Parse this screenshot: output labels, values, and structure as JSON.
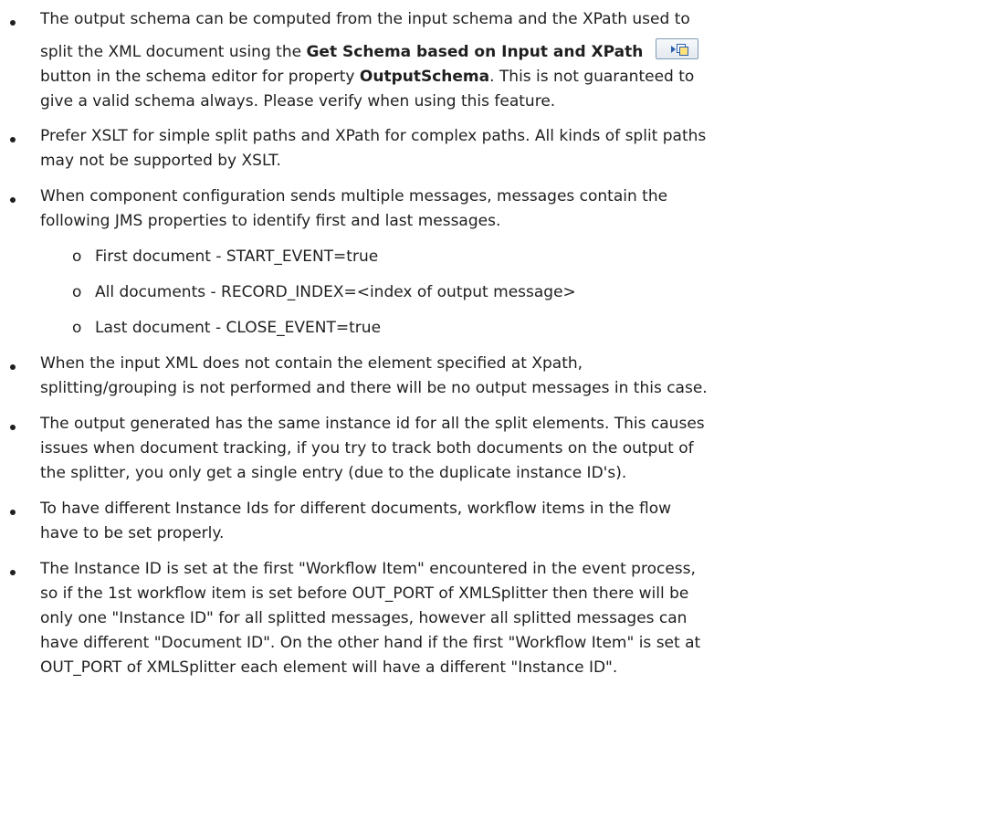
{
  "bullets": [
    {
      "lines": [
        "The output schema can be computed from the input schema and the XPath used to",
        {
          "pre": "split the XML document using the ",
          "bold": "Get Schema based on Input and XPath",
          "post": ""
        },
        {
          "pre": "button in the schema editor for property ",
          "bold": "OutputSchema",
          "post": ". This is not guaranteed to"
        },
        "give a valid schema always. Please verify when using this feature."
      ],
      "button_icon": "get-schema-icon"
    },
    {
      "lines": [
        "Prefer XSLT for simple split paths and XPath for complex paths. All kinds of split paths",
        "may not be supported by XSLT."
      ]
    },
    {
      "lines": [
        "When component configuration sends multiple messages, messages contain the",
        "following JMS properties to identify first and last messages."
      ],
      "sub_items": [
        "First document -  START_EVENT=true",
        "All documents -  RECORD_INDEX=<index of output message>",
        "Last document -  CLOSE_EVENT=true"
      ],
      "sub_marker": "o"
    },
    {
      "lines": [
        "When the input XML does not contain the element specified at Xpath,",
        "splitting/grouping is not performed and there will be no output messages in this case."
      ]
    },
    {
      "lines": [
        "The output generated has the same instance id for all the split elements. This causes",
        "issues when document tracking, if you try to track both documents on the output of",
        "the splitter, you only get a single entry (due to the duplicate instance ID's)."
      ]
    },
    {
      "lines": [
        "To have different Instance Ids for different documents, workflow items in the flow",
        "have to be set properly."
      ]
    },
    {
      "lines": [
        "The Instance ID is set at the first \"Workflow Item\" encountered in the event process,",
        "so if the 1st workflow item is set before OUT_PORT of XMLSplitter then there will be",
        "only one \"Instance ID\" for all splitted messages, however all splitted messages can",
        "have different \"Document ID\". On the other hand if the first \"Workflow Item\" is set at",
        "OUT_PORT of XMLSplitter each element will have a different \"Instance ID\"."
      ]
    }
  ]
}
